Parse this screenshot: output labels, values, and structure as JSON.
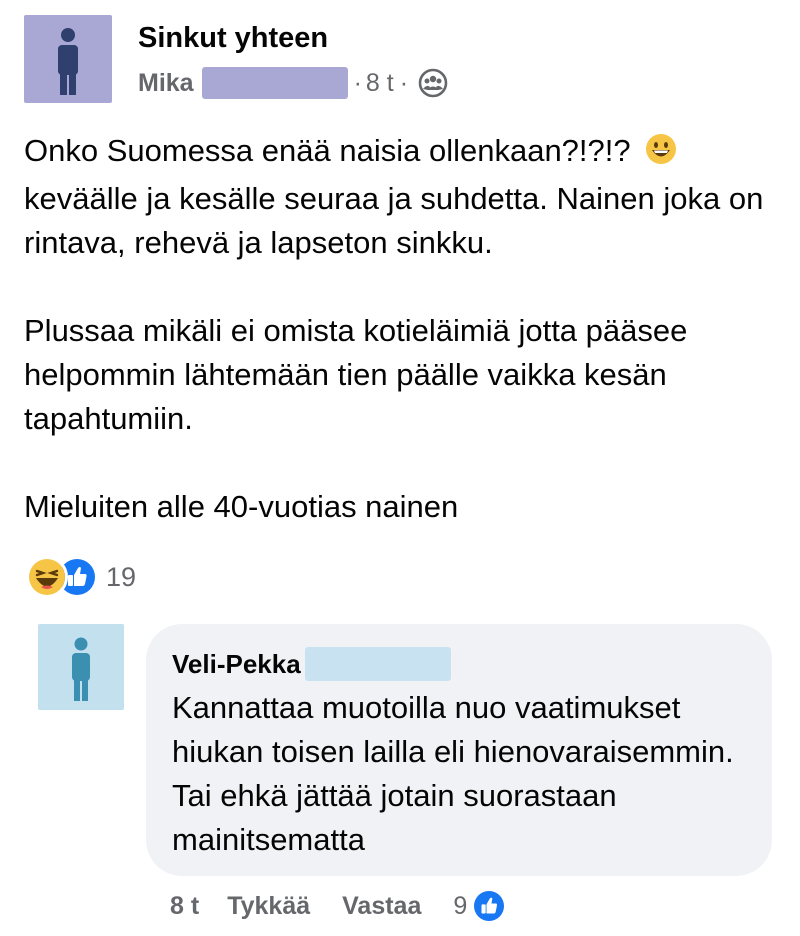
{
  "post": {
    "group_name": "Sinkut yhteen",
    "author": "Mika",
    "time": "8 t",
    "separator": "·",
    "privacy_icon": "group-privacy-icon",
    "paragraph1": "Onko Suomessa enää naisia ollenkaan?!?!? ",
    "paragraph1_rest": "keväälle ja kesälle seuraa ja suhdetta. Nainen joka on rintava, rehevä ja lapseton sinkku.",
    "paragraph2": "Plussaa mikäli ei omista kotieläimiä jotta pääsee helpommin lähtemään tien päälle vaikka kesän tapahtumiin.",
    "paragraph3": "Mieluiten alle 40-vuotias nainen",
    "inline_emoji": "grinning-face-emoji"
  },
  "reactions": {
    "types": [
      "haha",
      "like"
    ],
    "count": "19"
  },
  "comment": {
    "author": "Veli-Pekka",
    "text": "Kannattaa muotoilla nuo vaatimukset hiukan toisen lailla eli hienovaraisemmin. Tai ehkä jättää jotain suorastaan mainitsematta",
    "time": "8 t",
    "like_label": "Tykkää",
    "reply_label": "Vastaa",
    "reaction_count": "9"
  },
  "colors": {
    "post_avatar_bg": "#a9a8d4",
    "post_avatar_figure": "#2f3f6e",
    "comment_avatar_bg": "#c3e0ef",
    "comment_avatar_figure": "#3b8fb0",
    "like_blue": "#1877f2",
    "haha_yellow": "#f7c546",
    "bubble_bg": "#f0f2f5",
    "secondary_text": "#65676b"
  }
}
